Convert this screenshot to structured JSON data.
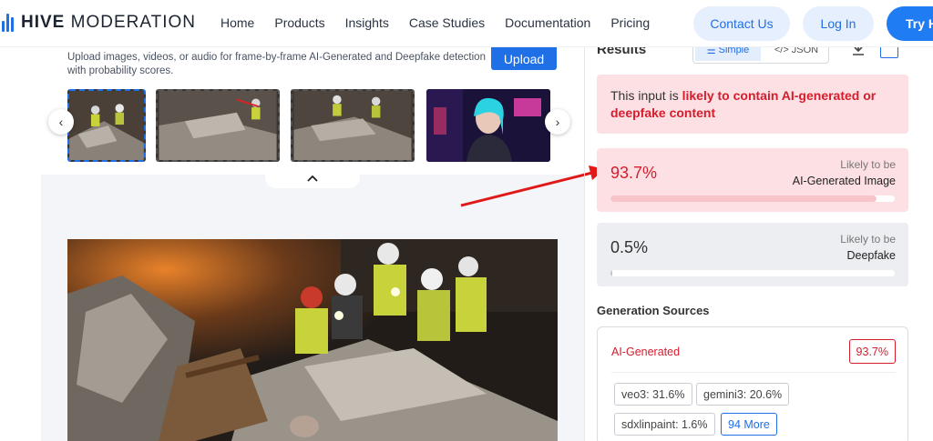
{
  "nav": {
    "logo_bold": "HIVE",
    "logo_rest": "MODERATION",
    "links": [
      "Home",
      "Products",
      "Insights",
      "Case Studies",
      "Documentation",
      "Pricing"
    ],
    "contact": "Contact Us",
    "login": "Log In",
    "try": "Try H"
  },
  "upload": {
    "description": "Upload images, videos, or audio for frame-by-frame AI-Generated and Deepfake detection with probability scores.",
    "button": "Upload"
  },
  "results": {
    "title": "Results",
    "toggle_simple": "Simple",
    "toggle_json": "JSON",
    "verdict_prefix": "This input is ",
    "verdict_bold": "likely to contain AI-generated or deepfake content",
    "ai": {
      "value": "93.7%",
      "fraction": 0.937,
      "sub": "Likely to be",
      "label": "AI-Generated Image"
    },
    "deepfake": {
      "value": "0.5%",
      "fraction": 0.005,
      "sub": "Likely to be",
      "label": "Deepfake"
    }
  },
  "sources": {
    "title": "Generation Sources",
    "label": "AI-Generated",
    "pct": "93.7%",
    "chips": [
      "veo3: 31.6%",
      "gemini3: 20.6%",
      "sdxlinpaint: 1.6%"
    ],
    "more": "94 More"
  },
  "colors": {
    "brand": "#1f6fe6",
    "alert": "#d61d2d",
    "alert_bg": "#fde0e3"
  }
}
